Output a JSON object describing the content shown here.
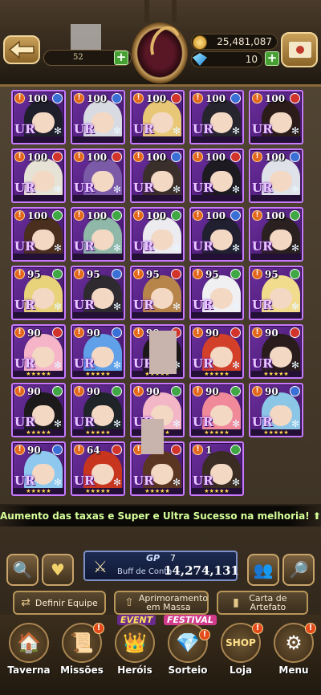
{
  "header": {
    "level_value": "52",
    "gold": "25,481,087",
    "gems": "10"
  },
  "colors": {
    "card_border": "#c77aff",
    "card_bg": "#6d2fa0",
    "notice_text": "#d6ff9a",
    "star": "#ffd84a"
  },
  "cards": [
    {
      "level": "100",
      "stars": 0,
      "hair": "#1f1f2b",
      "attr": "#3a6fd6"
    },
    {
      "level": "100",
      "stars": 0,
      "hair": "#d9dbe3",
      "attr": "#3a6fd6"
    },
    {
      "level": "100",
      "stars": 0,
      "hair": "#e8c876",
      "attr": "#d1342a"
    },
    {
      "level": "100",
      "stars": 0,
      "hair": "#26242c",
      "attr": "#3a6fd6"
    },
    {
      "level": "100",
      "stars": 0,
      "hair": "#2b1c1a",
      "attr": "#d1342a"
    },
    {
      "level": "100",
      "stars": 0,
      "hair": "#e6e2d6",
      "attr": "#d1342a"
    },
    {
      "level": "100",
      "stars": 0,
      "hair": "#7b5aa8",
      "attr": "#d1342a"
    },
    {
      "level": "100",
      "stars": 0,
      "hair": "#3a2f2a",
      "attr": "#3a6fd6"
    },
    {
      "level": "100",
      "stars": 0,
      "hair": "#1d1a22",
      "attr": "#d1342a"
    },
    {
      "level": "100",
      "stars": 0,
      "hair": "#dfe2e8",
      "attr": "#3a6fd6"
    },
    {
      "level": "100",
      "stars": 0,
      "hair": "#4a2e1e",
      "attr": "#3fa744"
    },
    {
      "level": "100",
      "stars": 0,
      "hair": "#8fb8a8",
      "attr": "#3fa744"
    },
    {
      "level": "100",
      "stars": 0,
      "hair": "#ececf0",
      "attr": "#3fa744"
    },
    {
      "level": "100",
      "stars": 0,
      "hair": "#202030",
      "attr": "#3a6fd6"
    },
    {
      "level": "100",
      "stars": 0,
      "hair": "#2a2020",
      "attr": "#3fa744"
    },
    {
      "level": "95",
      "stars": 0,
      "hair": "#e8d27a",
      "attr": "#3fa744"
    },
    {
      "level": "95",
      "stars": 0,
      "hair": "#2e2a30",
      "attr": "#3a6fd6"
    },
    {
      "level": "95",
      "stars": 0,
      "hair": "#b7844a",
      "attr": "#d1342a"
    },
    {
      "level": "95",
      "stars": 0,
      "hair": "#f0f0f3",
      "attr": "#3fa744"
    },
    {
      "level": "95",
      "stars": 0,
      "hair": "#f1dc8e",
      "attr": "#3fa744"
    },
    {
      "level": "90",
      "stars": 5,
      "hair": "#f5b4c8",
      "attr": "#d1342a"
    },
    {
      "level": "90",
      "stars": 5,
      "hair": "#5fa0e8",
      "attr": "#3a6fd6"
    },
    {
      "level": "90",
      "stars": 5,
      "hair": "#1c1818",
      "attr": "#d1342a"
    },
    {
      "level": "90",
      "stars": 5,
      "hair": "#d2402a",
      "attr": "#d1342a"
    },
    {
      "level": "90",
      "stars": 5,
      "hair": "#2a1c1c",
      "attr": "#d1342a"
    },
    {
      "level": "90",
      "stars": 5,
      "hair": "#1c1a1a",
      "attr": "#3fa744"
    },
    {
      "level": "90",
      "stars": 5,
      "hair": "#1e2428",
      "attr": "#3fa744"
    },
    {
      "level": "90",
      "stars": 5,
      "hair": "#f2b6c6",
      "attr": "#3fa744"
    },
    {
      "level": "90",
      "stars": 5,
      "hair": "#f08a9a",
      "attr": "#3fa744"
    },
    {
      "level": "90",
      "stars": 5,
      "hair": "#8cc6e6",
      "attr": "#3a6fd6"
    },
    {
      "level": "90",
      "stars": 5,
      "hair": "#8ec8ee",
      "attr": "#3a6fd6"
    },
    {
      "level": "64",
      "stars": 5,
      "hair": "#c8351e",
      "attr": "#d1342a"
    },
    {
      "level": "",
      "stars": 5,
      "hair": "#5a3622",
      "attr": "#d1342a"
    },
    {
      "level": "1",
      "stars": 5,
      "hair": "#3a2c22",
      "attr": "#3fa744"
    }
  ],
  "notice": "Aumento das taxas e Super e Ultra Sucesso na melhoria!",
  "toolbar": {
    "gp_label": "GP",
    "gp_value": "7",
    "buff_label": "Buff de Conta",
    "buff_value": "14,274,131",
    "define_team": "Definir Equipe",
    "mass_upgrade": "Aprimoramento em Massa",
    "artifact_card": "Carta de Artefato"
  },
  "nav": {
    "items": [
      {
        "label": "Taverna",
        "icon": "tavern-icon"
      },
      {
        "label": "Missões",
        "icon": "scroll-icon"
      },
      {
        "label": "Heróis",
        "icon": "heroes-icon"
      },
      {
        "label": "Sorteio",
        "icon": "crystal-icon"
      },
      {
        "label": "Loja",
        "icon": "shop-icon"
      },
      {
        "label": "Menu",
        "icon": "gear-icon"
      }
    ],
    "event_tag": "EVENT",
    "festival_tag": "FESTIVAL",
    "shop_tag": "SHOP"
  }
}
